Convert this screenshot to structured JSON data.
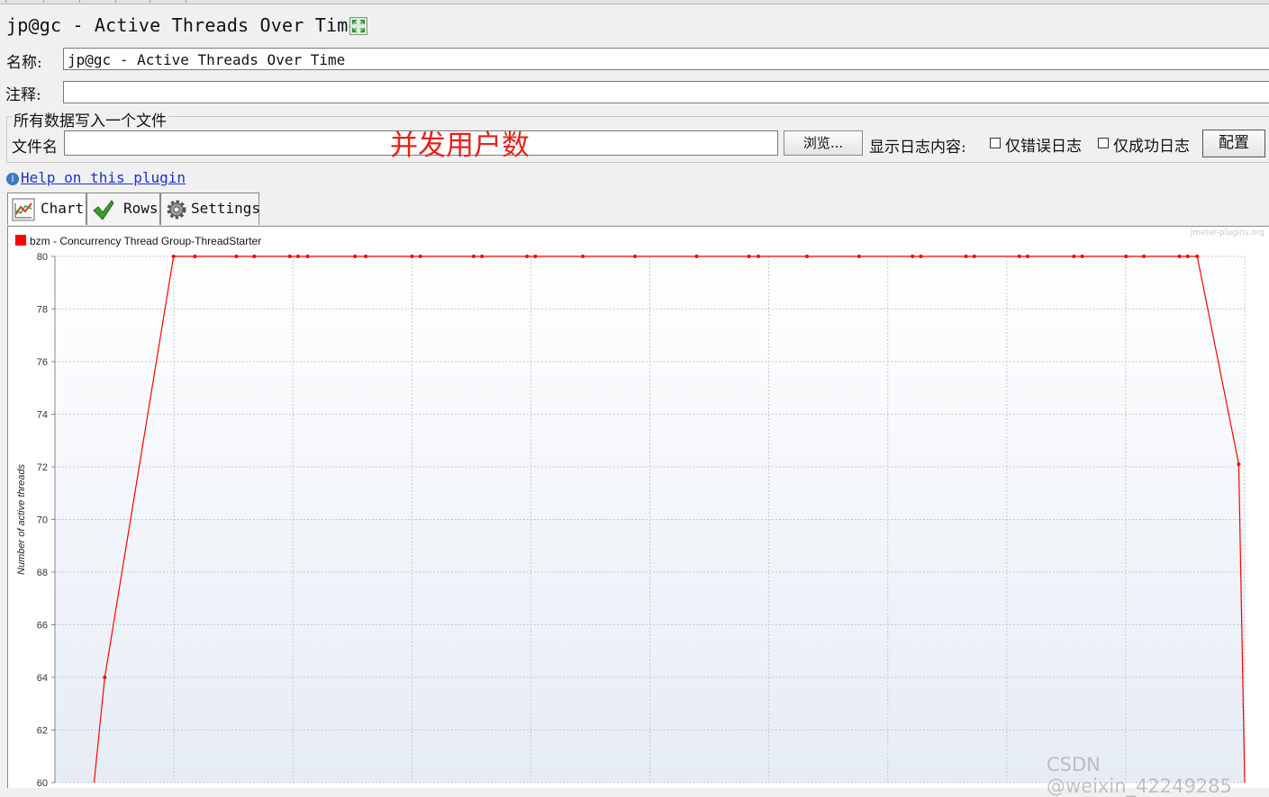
{
  "window": {
    "title": "jp@gc - Active Threads Over Time",
    "expand_icon": "expand-icon"
  },
  "form": {
    "name_label": "名称:",
    "name_value": "jp@gc - Active Threads Over Time",
    "comment_label": "注释:",
    "comment_value": "",
    "file_group_label": "所有数据写入一个文件",
    "filename_label": "文件名",
    "filename_value": "",
    "overlay_annotation": "并发用户数",
    "browse_button": "浏览...",
    "log_content_label": "显示日志内容:",
    "errors_only_label": "仅错误日志",
    "errors_only_checked": false,
    "success_only_label": "仅成功日志",
    "success_only_checked": false,
    "configure_button": "配置"
  },
  "help": {
    "text": "Help on this plugin",
    "icon": "info-icon"
  },
  "tabs": [
    {
      "label": "Chart",
      "icon": "chart-icon",
      "active": true
    },
    {
      "label": "Rows",
      "icon": "checkmark-icon",
      "active": false
    },
    {
      "label": "Settings",
      "icon": "gear-icon",
      "active": false
    }
  ],
  "chart_watermark": "jmeter-plugins.org",
  "page_watermark": "CSDN @weixin_42249285",
  "chart_data": {
    "type": "line",
    "title": "",
    "xlabel": "",
    "ylabel": "Number of active threads",
    "ylim": [
      60,
      80
    ],
    "yticks": [
      60,
      62,
      64,
      66,
      68,
      70,
      72,
      74,
      76,
      78,
      80
    ],
    "grid": true,
    "legend_position": "top-left",
    "colors": {
      "series": "#ff0000",
      "grid": "#c8c8c8",
      "bg_top": "#ffffff",
      "bg_bottom": "#e6ecf5"
    },
    "series": [
      {
        "name": "bzm - Concurrency Thread Group-ThreadStarter",
        "x": [
          0,
          0.45,
          3.35,
          4.25,
          6.0,
          6.75,
          8.25,
          8.6,
          9.0,
          11.0,
          11.45,
          13.4,
          13.75,
          16.0,
          16.35,
          18.25,
          18.6,
          20.6,
          22.8,
          25.4,
          27.6,
          28.0,
          30.05,
          32.25,
          34.5,
          34.85,
          36.75,
          37.1,
          39.0,
          39.35,
          41.3,
          41.65,
          43.5,
          44.25,
          45.75,
          46.1,
          46.5,
          48.25,
          48.5
        ],
        "values": [
          60,
          64,
          80,
          80,
          80,
          80,
          80,
          80,
          80,
          80,
          80,
          80,
          80,
          80,
          80,
          80,
          80,
          80,
          80,
          80,
          80,
          80,
          80,
          80,
          80,
          80,
          80,
          80,
          80,
          80,
          80,
          80,
          80,
          80,
          80,
          80,
          80,
          72.1,
          60
        ]
      }
    ]
  }
}
